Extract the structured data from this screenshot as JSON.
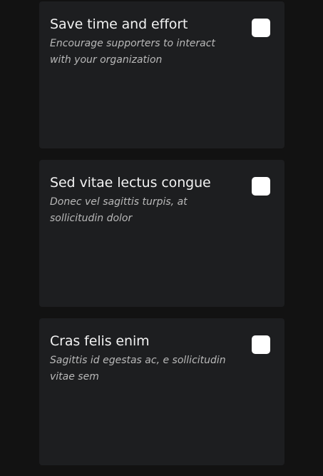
{
  "cards": [
    {
      "title": "Save time and effort",
      "description": "Encourage supporters to interact with your organization",
      "checked": false
    },
    {
      "title": "Sed vitae lectus congue",
      "description": "Donec vel sagittis turpis, at sollicitudin dolor",
      "checked": false
    },
    {
      "title": "Cras felis enim",
      "description": "Sagittis id egestas ac, e sollicitudin vitae sem",
      "checked": false
    }
  ]
}
